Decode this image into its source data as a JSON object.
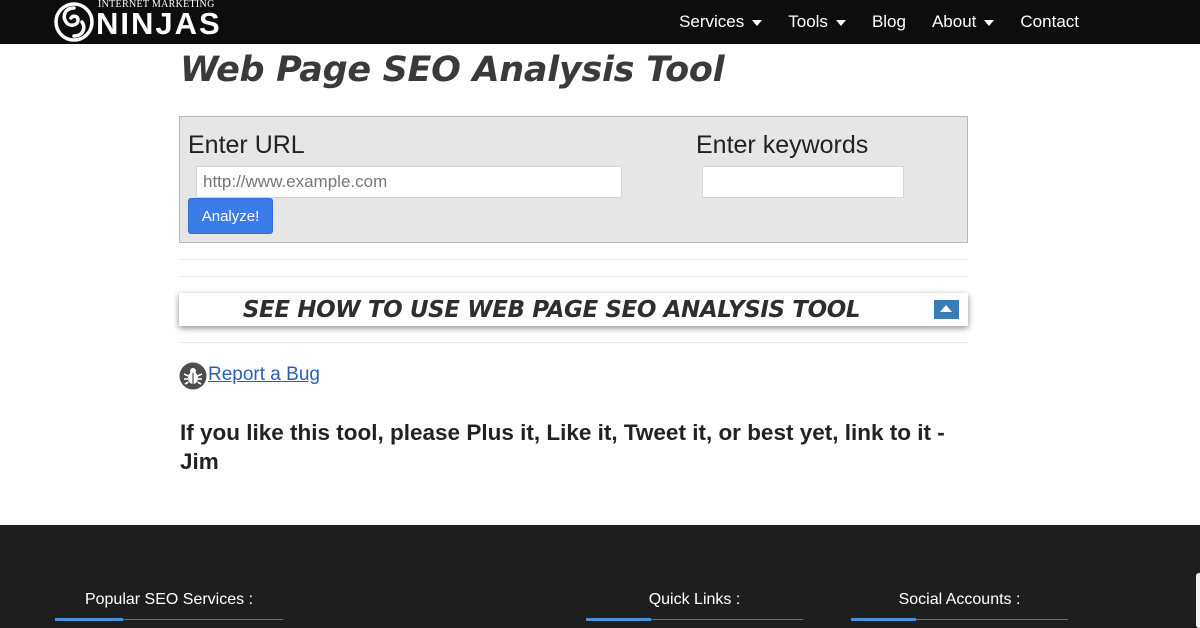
{
  "brand": {
    "small_text": "INTERNET MARKETING",
    "big_text": "NINJAS"
  },
  "nav": {
    "items": [
      {
        "label": "Services",
        "dropdown": true
      },
      {
        "label": "Tools",
        "dropdown": true
      },
      {
        "label": "Blog",
        "dropdown": false
      },
      {
        "label": "About",
        "dropdown": true
      },
      {
        "label": "Contact",
        "dropdown": false
      }
    ]
  },
  "main": {
    "title": "Web Page SEO Analysis Tool",
    "form": {
      "url_label": "Enter URL",
      "url_placeholder": "http://www.example.com",
      "url_value": "",
      "keywords_label": "Enter keywords",
      "keywords_value": "",
      "analyze_label": "Analyze!"
    },
    "howto_label": "SEE HOW TO USE WEB PAGE SEO ANALYSIS TOOL",
    "report_bug_label": "Report a Bug",
    "plea_text": "If you like this tool, please Plus it, Like it, Tweet it, or best yet, link to it - Jim"
  },
  "footer": {
    "columns": [
      {
        "title": "Popular SEO Services :"
      },
      {
        "title": "Quick Links :"
      },
      {
        "title": "Social Accounts :"
      }
    ]
  },
  "colors": {
    "nav_bg": "#0d0d0d",
    "accent_blue": "#3a7ce8",
    "toggle_blue": "#3a7bb8",
    "link_blue": "#2a5fb5",
    "footer_bg": "#1e1e1e",
    "footer_accent": "#4a90d9"
  },
  "icons": {
    "logo": "swirl-logo-icon",
    "dropdown": "caret-down-icon",
    "toggle": "caret-up-icon",
    "bug": "bug-icon"
  }
}
